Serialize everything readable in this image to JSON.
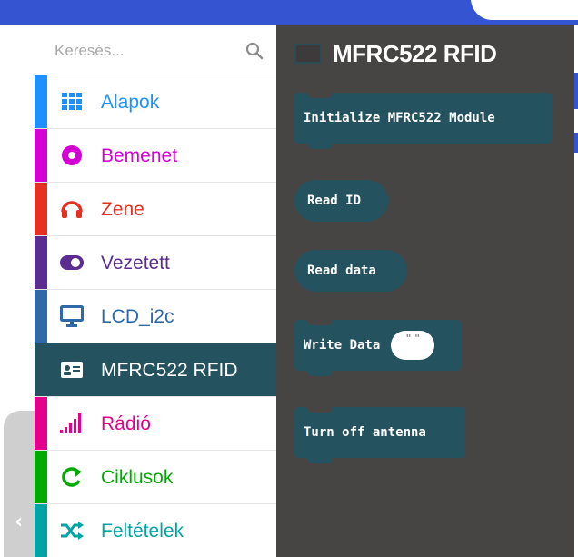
{
  "search": {
    "placeholder": "Keresés..."
  },
  "categories": [
    {
      "label": "Alapok",
      "color": "#1e90ff",
      "icon": "grid-icon"
    },
    {
      "label": "Bemenet",
      "color": "#d400d4",
      "icon": "circle-dot-icon"
    },
    {
      "label": "Zene",
      "color": "#e63022",
      "icon": "headphones-icon"
    },
    {
      "label": "Vezetett",
      "color": "#5c2d91",
      "icon": "toggle-icon"
    },
    {
      "label": "LCD_i2c",
      "color": "#2f69a8",
      "icon": "monitor-icon"
    },
    {
      "label": "MFRC522 RFID",
      "color": "#24525e",
      "icon": "id-card-icon",
      "active": true
    },
    {
      "label": "Rádió",
      "color": "#e3008c",
      "icon": "signal-bars-icon"
    },
    {
      "label": "Ciklusok",
      "color": "#00aa00",
      "icon": "loop-icon"
    },
    {
      "label": "Feltételek",
      "color": "#00a4a6",
      "icon": "shuffle-icon"
    }
  ],
  "flyout": {
    "title": "MFRC522 RFID",
    "blocks": [
      {
        "label": "Initialize MFRC522 Module",
        "kind": "statement"
      },
      {
        "label": "Read ID",
        "kind": "reporter"
      },
      {
        "label": "Read data",
        "kind": "reporter"
      },
      {
        "label": "Write Data",
        "kind": "statement",
        "string_value": "\" \""
      },
      {
        "label": "Turn off antenna",
        "kind": "statement"
      }
    ]
  },
  "colors": {
    "topbar": "#3454d1",
    "flyout_bg": "#474444",
    "block": "#24525e"
  }
}
